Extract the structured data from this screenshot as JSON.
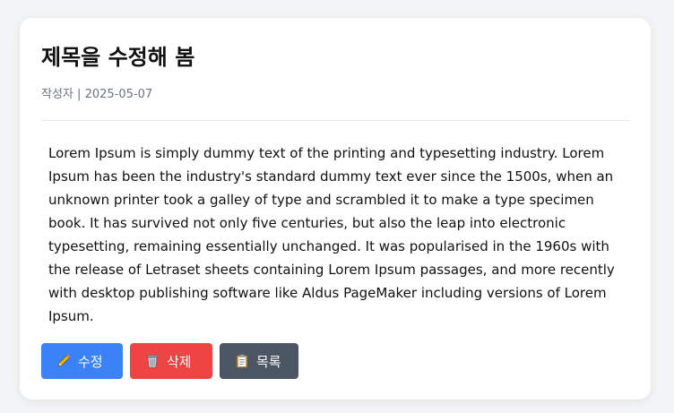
{
  "post": {
    "title": "제목을 수정해 봄",
    "author": "작성자",
    "separator": "|",
    "date": "2025-05-07",
    "body": "Lorem Ipsum is simply dummy text of the printing and typesetting industry. Lorem Ipsum has been the industry's standard dummy text ever since the 1500s, when an unknown printer took a galley of type and scrambled it to make a type specimen book. It has survived not only five centuries, but also the leap into electronic typesetting, remaining essentially unchanged. It was popularised in the 1960s with the release of Letraset sheets containing Lorem Ipsum passages, and more recently with desktop publishing software like Aldus PageMaker including versions of Lorem Ipsum."
  },
  "actions": {
    "edit_label": "수정",
    "edit_icon": "pencil-icon",
    "delete_label": "삭제",
    "delete_icon": "wastebasket-icon",
    "list_label": "목록",
    "list_icon": "clipboard-icon"
  },
  "colors": {
    "edit": "#3b82f6",
    "delete": "#ef4444",
    "list": "#4b5563"
  }
}
